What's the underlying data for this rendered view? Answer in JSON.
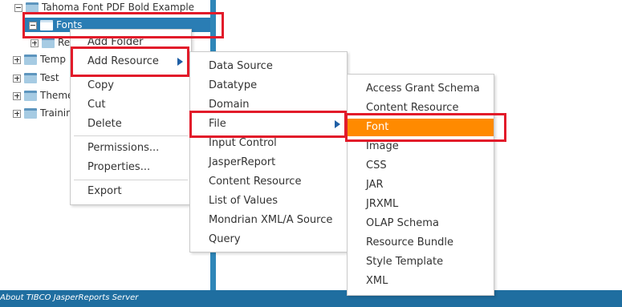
{
  "tree": {
    "root_label": "Tahoma Font PDF Bold Example",
    "fonts_label": "Fonts",
    "partial_sub_label": "Rep",
    "items": [
      "Temp",
      "Test",
      "Themes",
      "Training"
    ]
  },
  "context_menu": {
    "add_folder": "Add Folder",
    "add_resource": "Add Resource",
    "copy": "Copy",
    "cut": "Cut",
    "delete": "Delete",
    "permissions": "Permissions...",
    "properties": "Properties...",
    "export": "Export"
  },
  "resource_menu": {
    "data_source": "Data Source",
    "datatype": "Datatype",
    "domain": "Domain",
    "file": "File",
    "input_control": "Input Control",
    "jasperreport": "JasperReport",
    "content_resource": "Content Resource",
    "list_of_values": "List of Values",
    "mondrian_xmla_source": "Mondrian XML/A Source",
    "query": "Query"
  },
  "file_menu": {
    "access_grant_schema": "Access Grant Schema",
    "content_resource": "Content Resource",
    "font": "Font",
    "image": "Image",
    "css": "CSS",
    "jar": "JAR",
    "jrxml": "JRXML",
    "olap_schema": "OLAP Schema",
    "resource_bundle": "Resource Bundle",
    "style_template": "Style Template",
    "xml": "XML"
  },
  "footer": {
    "about_link": "About TIBCO JasperReports Server"
  },
  "colors": {
    "selected_row": "#2a7db4",
    "active_item": "#ff8a00",
    "highlight_box": "#e21b2a",
    "footer_bar": "#1f6ea0"
  }
}
